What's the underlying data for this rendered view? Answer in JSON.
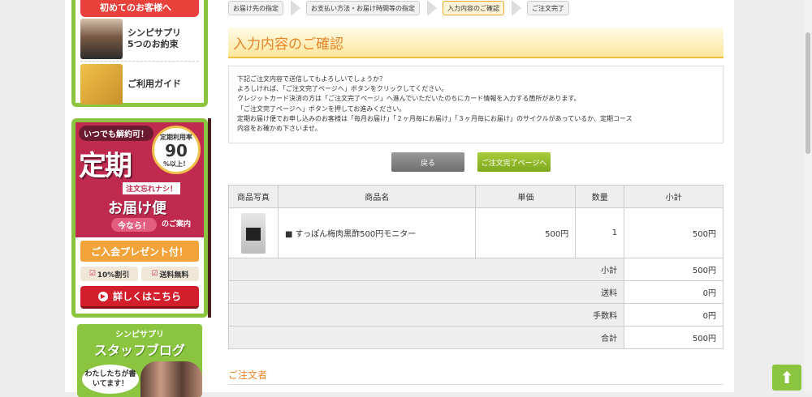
{
  "sidebar": {
    "guide_header": "初めてのお客様へ",
    "guide_items": [
      {
        "label_line1": "シンピサプリ",
        "label_line2": "5つのお約束"
      },
      {
        "label_line1": "ご利用ガイド",
        "label_line2": ""
      }
    ],
    "teiki": {
      "top_text": "いつでも解約可！",
      "big_text": "定期",
      "rate_label": "定期利用率",
      "rate_value": "90",
      "rate_unit": "%以上！",
      "sub_text": "注文忘れナシ！",
      "mid_text": "お届け便",
      "now_text": "今なら！",
      "guide_text": "のご案内",
      "present_text": "ご入会プレゼント付！",
      "chip1": "10%割引",
      "chip2": "送料無料",
      "detail_button": "詳しくはこちら"
    },
    "blog": {
      "title1": "シンピサプリ",
      "title2": "スタッフブログ",
      "bubble": "わたしたちが書いてます！"
    }
  },
  "steps": [
    "お届け先の指定",
    "お支払い方法・お届け時間等の指定",
    "入力内容のご確認",
    "ご注文完了"
  ],
  "page_title": "入力内容のご確認",
  "notice_lines": [
    "下記ご注文内容で送信してもよろしいでしょうか？",
    "よろしければ、「ご注文完了ページへ」ボタンをクリックしてください。",
    "クレジットカード決済の方は「ご注文完了ページ」へ進んでいただいたのちにカード情報を入力する箇所があります。",
    "「ご注文完了ページへ」ボタンを押してお進みください。",
    "定期お届け便でお申し込みのお客様は「毎月お届け」「２ヶ月毎にお届け」「３ヶ月毎にお届け」のサイクルがあっているか、定期コース",
    "内容をお確かめ下さいませ。"
  ],
  "buttons": {
    "back": "戻る",
    "next": "ご注文完了ページへ"
  },
  "table": {
    "headers": [
      "商品写真",
      "商品名",
      "単価",
      "数量",
      "小計"
    ],
    "product": {
      "name": "■ すっぽん梅肉黒酢500円モニター",
      "price": "500円",
      "qty": "1",
      "subtotal": "500円"
    },
    "summary": [
      {
        "label": "小計",
        "value": "500円"
      },
      {
        "label": "送料",
        "value": "0円"
      },
      {
        "label": "手数料",
        "value": "0円"
      },
      {
        "label": "合計",
        "value": "500円"
      }
    ]
  },
  "orderer_title": "ご注文者"
}
